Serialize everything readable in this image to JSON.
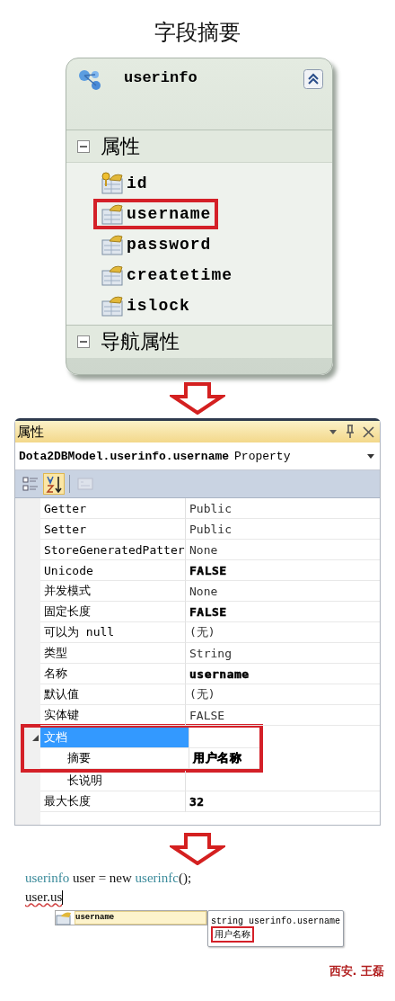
{
  "page_title": "字段摘要",
  "entity": {
    "name": "userinfo",
    "collapsed": false,
    "sections": [
      {
        "label": "属性",
        "expanded": true,
        "items": [
          {
            "name": "id",
            "key": true,
            "annotated": false
          },
          {
            "name": "username",
            "key": false,
            "annotated": true
          },
          {
            "name": "password",
            "key": false,
            "annotated": false
          },
          {
            "name": "createtime",
            "key": false,
            "annotated": false
          },
          {
            "name": "islock",
            "key": false,
            "annotated": false
          }
        ]
      },
      {
        "label": "导航属性",
        "expanded": true
      }
    ]
  },
  "properties_panel": {
    "title": "属性",
    "selector": {
      "object": "Dota2DBModel.userinfo.username",
      "type": "Property"
    },
    "toolbar": [
      {
        "kind": "categorized",
        "selected": false,
        "disabled": false
      },
      {
        "kind": "alphabetical",
        "selected": true,
        "disabled": false
      },
      {
        "kind": "pages",
        "selected": false,
        "disabled": true
      }
    ],
    "rows": [
      {
        "kind": "property",
        "name": "Getter",
        "value": "Public",
        "bold": false,
        "annotated": false
      },
      {
        "kind": "property",
        "name": "Setter",
        "value": "Public",
        "bold": false,
        "annotated": false
      },
      {
        "kind": "property",
        "name": "StoreGeneratedPatter",
        "value": "None",
        "bold": false,
        "annotated": false
      },
      {
        "kind": "property",
        "name": "Unicode",
        "value": "FALSE",
        "bold": true,
        "annotated": false
      },
      {
        "kind": "property",
        "name": "并发模式",
        "value": "None",
        "bold": false,
        "annotated": false
      },
      {
        "kind": "property",
        "name": "固定长度",
        "value": "FALSE",
        "bold": true,
        "annotated": false
      },
      {
        "kind": "property",
        "name": "可以为 null",
        "value": "(无)",
        "bold": false,
        "annotated": false
      },
      {
        "kind": "property",
        "name": "类型",
        "value": "String",
        "bold": false,
        "annotated": false
      },
      {
        "kind": "property",
        "name": "名称",
        "value": "username",
        "bold": true,
        "annotated": false
      },
      {
        "kind": "property",
        "name": "默认值",
        "value": "(无)",
        "bold": false,
        "annotated": false
      },
      {
        "kind": "property",
        "name": "实体键",
        "value": "FALSE",
        "bold": false,
        "annotated": false
      },
      {
        "kind": "category",
        "name": "文档",
        "expanded": true,
        "selected": true,
        "annotated": true,
        "children": [
          {
            "kind": "property",
            "name": "摘要",
            "value": "用户名称",
            "bold": true,
            "annotated": true
          },
          {
            "kind": "property",
            "name": "长说明",
            "annotated": false
          }
        ]
      },
      {
        "kind": "property",
        "name": "最大长度",
        "value": "32",
        "bold": true,
        "annotated": false
      }
    ]
  },
  "code_editor": {
    "lines": [
      [
        {
          "kind": "type",
          "text": "userinfo"
        },
        {
          "kind": "plain",
          "text": " user = new "
        },
        {
          "kind": "type",
          "text": "userinfc"
        },
        {
          "kind": "plain",
          "text": "();"
        }
      ],
      [
        {
          "kind": "error",
          "text": "user.us"
        }
      ]
    ],
    "completion": {
      "items": [
        {
          "name": "username",
          "selected": true
        }
      ]
    },
    "tooltip": {
      "signature": "string userinfo.username",
      "summary": "用户名称",
      "summary_annotated": true
    }
  },
  "author_note": "西安. 王磊"
}
